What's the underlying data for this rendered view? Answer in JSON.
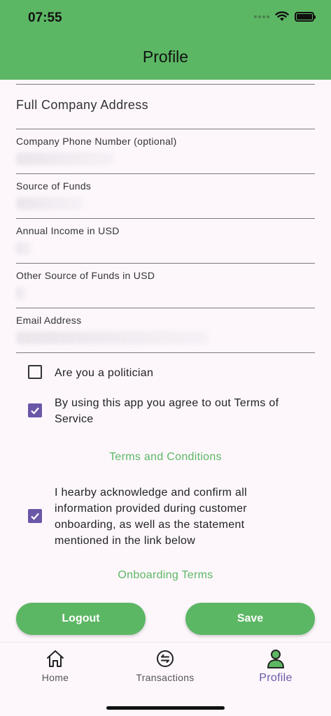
{
  "status_bar": {
    "time": "07:55"
  },
  "header": {
    "title": "Profile"
  },
  "form": {
    "company_address": {
      "label": "Full Company Address"
    },
    "company_phone": {
      "label": "Company Phone Number (optional)"
    },
    "source_of_funds": {
      "label": "Source of Funds"
    },
    "annual_income": {
      "label": "Annual Income in USD"
    },
    "other_source": {
      "label": "Other Source of Funds in USD"
    },
    "email": {
      "label": "Email Address"
    }
  },
  "checkboxes": {
    "politician": {
      "label": "Are you a politician",
      "checked": false
    },
    "terms": {
      "label": "By using this app you agree to out Terms of Service",
      "checked": true
    },
    "acknowledge": {
      "label": "I hearby acknowledge and confirm all information provided during customer onboarding, as well as the statement mentioned in the link below",
      "checked": true
    }
  },
  "links": {
    "terms_and_conditions": "Terms and Conditions",
    "onboarding_terms": "Onboarding Terms"
  },
  "buttons": {
    "logout": "Logout",
    "save": "Save"
  },
  "tabbar": {
    "items": [
      {
        "label": "Home",
        "icon": "home-icon",
        "active": false
      },
      {
        "label": "Transactions",
        "icon": "transfer-icon",
        "active": false
      },
      {
        "label": "Profile",
        "icon": "person-icon",
        "active": true
      }
    ]
  },
  "colors": {
    "accent_green": "#5cb764",
    "checkbox_purple": "#6a57a8"
  }
}
